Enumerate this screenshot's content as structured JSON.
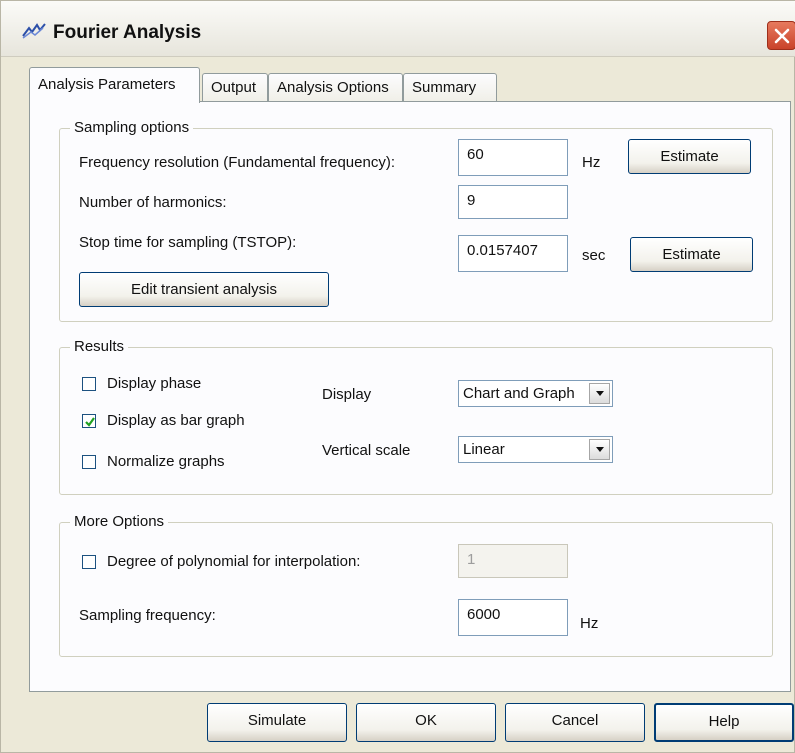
{
  "window": {
    "title": "Fourier Analysis"
  },
  "tabs": [
    {
      "label": "Analysis Parameters",
      "active": true
    },
    {
      "label": "Output",
      "active": false
    },
    {
      "label": "Analysis Options",
      "active": false
    },
    {
      "label": "Summary",
      "active": false
    }
  ],
  "sampling": {
    "title": "Sampling options",
    "freq_label": "Frequency resolution (Fundamental frequency):",
    "freq_value": "60",
    "freq_unit": "Hz",
    "estimate1": "Estimate",
    "harmonics_label": "Number of harmonics:",
    "harmonics_value": "9",
    "stop_label": "Stop time for sampling (TSTOP):",
    "stop_value": "0.0157407",
    "stop_unit": "sec",
    "estimate2": "Estimate",
    "edit_transient": "Edit transient analysis"
  },
  "results": {
    "title": "Results",
    "display_phase": "Display phase",
    "display_phase_checked": false,
    "bar_graph": "Display as bar graph",
    "bar_graph_checked": true,
    "normalize": "Normalize graphs",
    "normalize_checked": false,
    "display_label": "Display",
    "display_value": "Chart and Graph",
    "vscale_label": "Vertical scale",
    "vscale_value": "Linear"
  },
  "more": {
    "title": "More Options",
    "poly_label": "Degree of polynomial for interpolation:",
    "poly_checked": false,
    "poly_value": "1",
    "sampling_label": "Sampling frequency:",
    "sampling_value": "6000",
    "sampling_unit": "Hz"
  },
  "footer": {
    "simulate": "Simulate",
    "ok": "OK",
    "cancel": "Cancel",
    "help": "Help"
  },
  "colors": {
    "close_button": "#d9532f",
    "panel": "#fcfcfe",
    "dialog": "#ece9d8"
  }
}
